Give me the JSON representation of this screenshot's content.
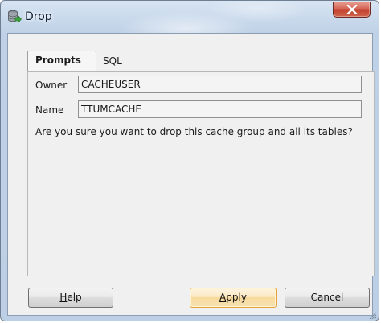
{
  "window": {
    "title": "Drop",
    "close_label": "X"
  },
  "tabs": [
    {
      "label": "Prompts",
      "selected": true
    },
    {
      "label": "SQL",
      "selected": false
    }
  ],
  "form": {
    "owner_label": "Owner",
    "owner_value": "CACHEUSER",
    "name_label": "Name",
    "name_value": "TTUMCACHE",
    "question": "Are you sure you want to drop this cache group and all its tables?"
  },
  "buttons": {
    "help": {
      "mnemonic": "H",
      "rest": "elp"
    },
    "apply": {
      "mnemonic": "A",
      "rest": "pply"
    },
    "cancel": "Cancel"
  },
  "colors": {
    "close_button": "#c9473a",
    "default_button_border": "#e5a13a",
    "titlebar": "#c5d6ea"
  },
  "icons": {
    "app": "database-drop-icon",
    "close": "close-icon",
    "resize": "resize-grip-icon"
  }
}
